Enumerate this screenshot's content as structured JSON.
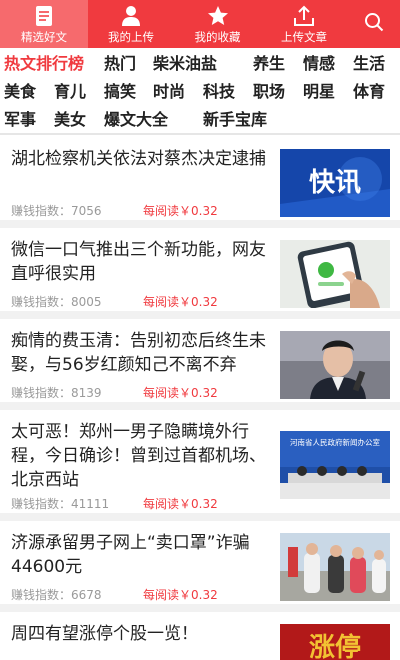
{
  "nav": {
    "items": [
      {
        "label": "精选好文",
        "icon": "document-icon"
      },
      {
        "label": "我的上传",
        "icon": "user-icon"
      },
      {
        "label": "我的收藏",
        "icon": "star-icon"
      },
      {
        "label": "上传文章",
        "icon": "upload-icon"
      }
    ],
    "search_icon": "search-icon",
    "colors": {
      "bar": "#f03a3f",
      "active": "#f66a6d"
    }
  },
  "categories": [
    "热文排行榜",
    "热门",
    "柴米油盐",
    "养生",
    "情感",
    "生活",
    "美食",
    "育儿",
    "搞笑",
    "时尚",
    "科技",
    "职场",
    "明星",
    "体育",
    "军事",
    "美女",
    "爆文大全",
    "新手宝库"
  ],
  "active_category": "热文排行榜",
  "articles": [
    {
      "title": "湖北检察机关依法对蔡杰决定逮捕",
      "index": "赚钱指数：7056",
      "read": "每阅读￥0.32",
      "thumb_text": "快讯"
    },
    {
      "title": "微信一口气推出三个新功能，网友直呼很实用",
      "index": "赚钱指数：8005",
      "read": "每阅读￥0.32"
    },
    {
      "title": "痴情的费玉清：告别初恋后终生未娶，与56岁红颜知己不离不弃",
      "index": "赚钱指数：8139",
      "read": "每阅读￥0.32"
    },
    {
      "title": "太可恶！郑州一男子隐瞒境外行程，今日确诊！曾到过首都机场、北京西站",
      "index": "赚钱指数：41111",
      "read": "每阅读￥0.32",
      "thumb_text": "河南省人民政府新闻办公室"
    },
    {
      "title": "济源承留男子网上“卖口罩”诈骗44600元",
      "index": "赚钱指数：6678",
      "read": "每阅读￥0.32"
    },
    {
      "title": "周四有望涨停个股一览！",
      "thumb_text": "涨停"
    }
  ]
}
